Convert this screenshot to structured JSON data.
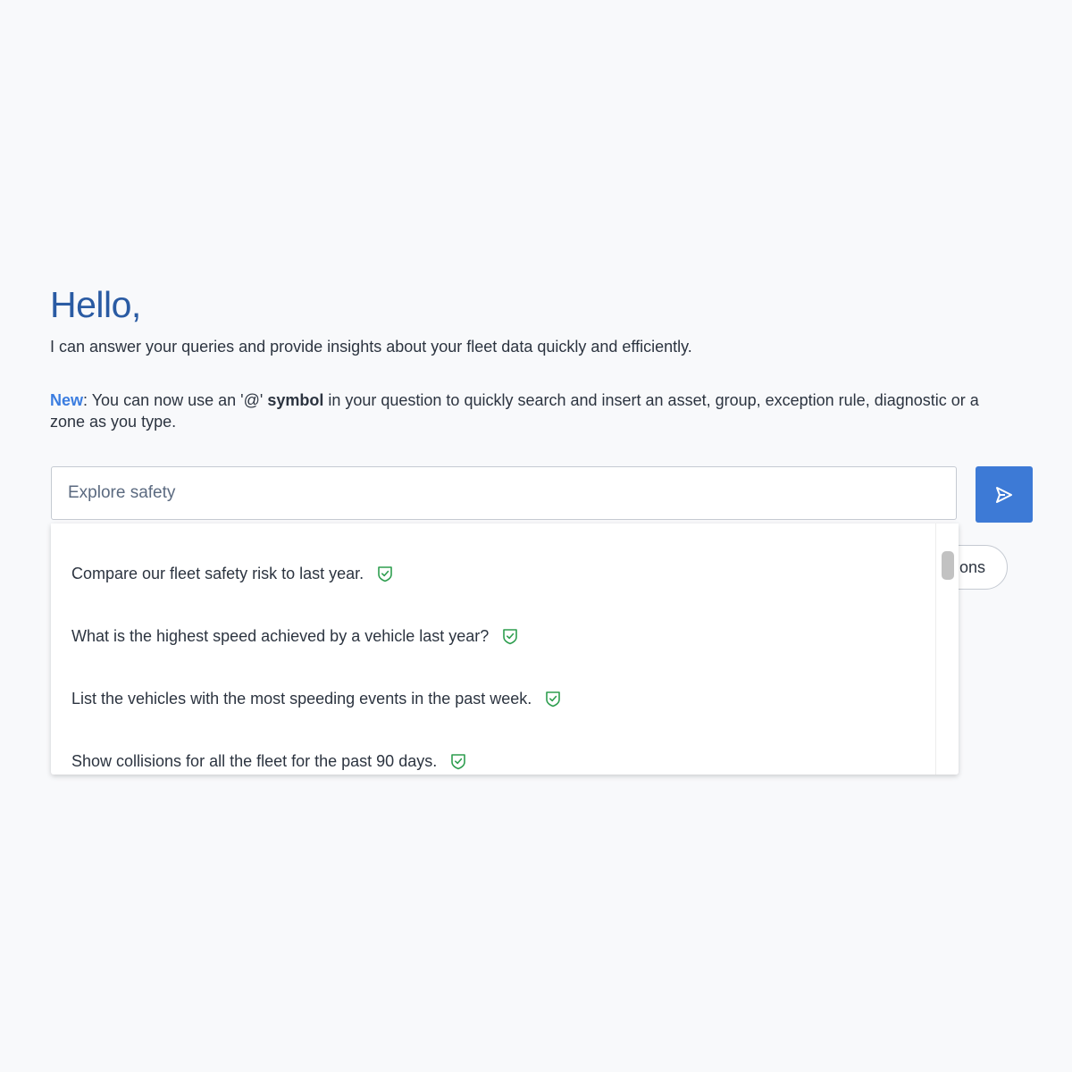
{
  "header": {
    "greeting": "Hello,",
    "intro": "I can answer your queries and provide insights about your fleet data quickly and efficiently."
  },
  "notice": {
    "new_label": "New",
    "text_before": ": You can now use an '@' ",
    "bold_word": "symbol",
    "text_after": " in your question to quickly search and insert an asset, group, exception rule, diagnostic or a zone as you type."
  },
  "search": {
    "value": "",
    "placeholder": "Explore safety"
  },
  "peek_button": {
    "label": "ons"
  },
  "suggestions": [
    {
      "text": "Compare our fleet safety risk to last year.",
      "icon": "shield-check-icon"
    },
    {
      "text": "What is the highest speed achieved by a vehicle last year?",
      "icon": "shield-check-icon"
    },
    {
      "text": "List the vehicles with the most speeding events in the past week.",
      "icon": "shield-check-icon"
    },
    {
      "text": "Show collisions for all the fleet for the past 90 days.",
      "icon": "shield-check-icon"
    }
  ],
  "colors": {
    "accent": "#3d7ad6",
    "greeting": "#2a5ba3",
    "verified": "#2e9e4f"
  },
  "icons": {
    "send": "send-arrow-icon",
    "verified": "shield-check-icon"
  }
}
